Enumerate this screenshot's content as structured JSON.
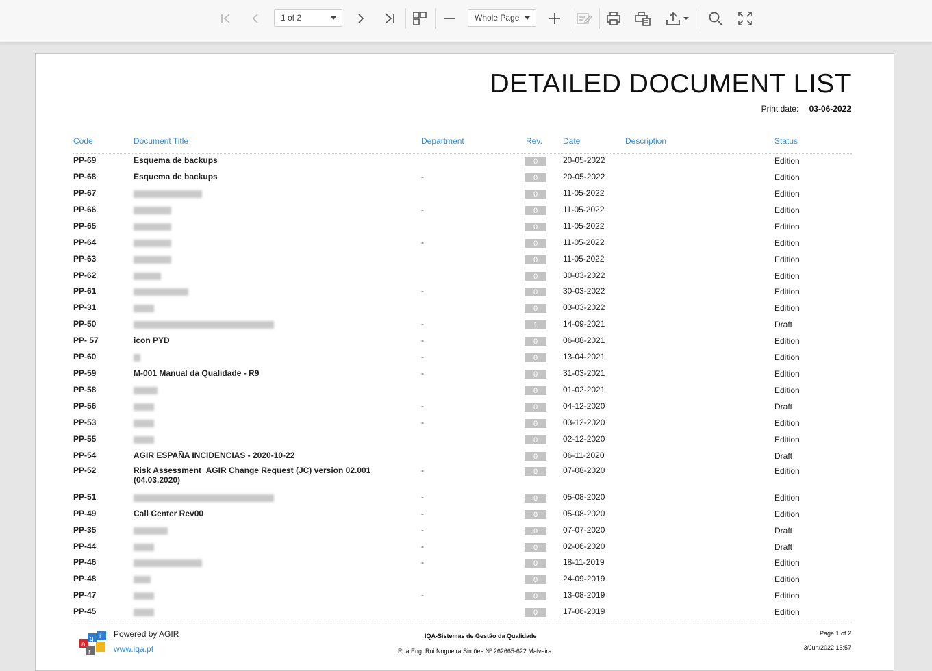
{
  "toolbar": {
    "page_select": "1 of 2",
    "zoom_select": "Whole Page"
  },
  "report": {
    "title": "DETAILED DOCUMENT LIST",
    "print_date_label": "Print date:",
    "print_date": "03-06-2022",
    "columns": {
      "code": "Code",
      "title": "Document Title",
      "department": "Department",
      "rev": "Rev.",
      "date": "Date",
      "description": "Description",
      "status": "Status"
    },
    "rows": [
      {
        "code": "PP-69",
        "title": "Esquema de backups",
        "dept": "",
        "rev": "0",
        "date": "20-05-2022",
        "status": "Edition"
      },
      {
        "code": "PP-68",
        "title": "Esquema de backups",
        "dept": "-",
        "rev": "0",
        "date": "20-05-2022",
        "status": "Edition"
      },
      {
        "code": "PP-67",
        "title": "",
        "dept": "",
        "rev": "0",
        "date": "11-05-2022",
        "status": "Edition"
      },
      {
        "code": "PP-66",
        "title": "",
        "dept": "-",
        "rev": "0",
        "date": "11-05-2022",
        "status": "Edition"
      },
      {
        "code": "PP-65",
        "title": "",
        "dept": "",
        "rev": "0",
        "date": "11-05-2022",
        "status": "Edition"
      },
      {
        "code": "PP-64",
        "title": "",
        "dept": "-",
        "rev": "0",
        "date": "11-05-2022",
        "status": "Edition"
      },
      {
        "code": "PP-63",
        "title": "",
        "dept": "",
        "rev": "0",
        "date": "11-05-2022",
        "status": "Edition"
      },
      {
        "code": "PP-62",
        "title": "",
        "dept": "",
        "rev": "0",
        "date": "30-03-2022",
        "status": "Edition"
      },
      {
        "code": "PP-61",
        "title": "",
        "dept": "-",
        "rev": "0",
        "date": "30-03-2022",
        "status": "Edition"
      },
      {
        "code": "PP-31",
        "title": "",
        "dept": "",
        "rev": "0",
        "date": "03-03-2022",
        "status": "Edition"
      },
      {
        "code": "PP-50",
        "title": "",
        "dept": "-",
        "rev": "1",
        "date": "14-09-2021",
        "status": "Draft"
      },
      {
        "code": "PP- 57",
        "title": "icon PYD",
        "dept": "-",
        "rev": "0",
        "date": "06-08-2021",
        "status": "Edition"
      },
      {
        "code": "PP-60",
        "title": "",
        "dept": "-",
        "rev": "0",
        "date": "13-04-2021",
        "status": "Edition"
      },
      {
        "code": "PP-59",
        "title": "M-001 Manual da Qualidade - R9",
        "dept": "-",
        "rev": "0",
        "date": "31-03-2021",
        "status": "Edition"
      },
      {
        "code": "PP-58",
        "title": "",
        "dept": "",
        "rev": "0",
        "date": "01-02-2021",
        "status": "Edition"
      },
      {
        "code": "PP-56",
        "title": "",
        "dept": "-",
        "rev": "0",
        "date": "04-12-2020",
        "status": "Draft"
      },
      {
        "code": "PP-53",
        "title": "",
        "dept": "-",
        "rev": "0",
        "date": "03-12-2020",
        "status": "Edition"
      },
      {
        "code": "PP-55",
        "title": "",
        "dept": "",
        "rev": "0",
        "date": "02-12-2020",
        "status": "Edition"
      },
      {
        "code": "PP-54",
        "title": "AGIR ESPAÑA INCIDENCIAS - 2020-10-22",
        "dept": "",
        "rev": "0",
        "date": "06-11-2020",
        "status": "Draft"
      },
      {
        "code": "PP-52",
        "title": "Risk Assessment_AGIR Change Request (JC) version 02.001 (04.03.2020)",
        "dept": "-",
        "rev": "0",
        "date": "07-08-2020",
        "status": "Edition"
      },
      {
        "code": "PP-51",
        "title": "",
        "dept": "-",
        "rev": "0",
        "date": "05-08-2020",
        "status": "Edition"
      },
      {
        "code": "PP-49",
        "title": "Call Center Rev00",
        "dept": "-",
        "rev": "0",
        "date": "05-08-2020",
        "status": "Edition"
      },
      {
        "code": "PP-35",
        "title": "",
        "dept": "-",
        "rev": "0",
        "date": "07-07-2020",
        "status": "Draft"
      },
      {
        "code": "PP-44",
        "title": "",
        "dept": "-",
        "rev": "0",
        "date": "02-06-2020",
        "status": "Draft"
      },
      {
        "code": "PP-46",
        "title": "",
        "dept": "-",
        "rev": "0",
        "date": "18-11-2019",
        "status": "Edition"
      },
      {
        "code": "PP-48",
        "title": "",
        "dept": "",
        "rev": "0",
        "date": "24-09-2019",
        "status": "Edition"
      },
      {
        "code": "PP-47",
        "title": "",
        "dept": "-",
        "rev": "0",
        "date": "13-08-2019",
        "status": "Edition"
      },
      {
        "code": "PP-45",
        "title": "",
        "dept": "",
        "rev": "0",
        "date": "17-06-2019",
        "status": "Edition"
      }
    ],
    "footer": {
      "powered": "Powered by AGIR",
      "site": "www.iqa.pt",
      "company": "IQA-Sistemas de Gestão da Qualidade",
      "address": "Rua Eng. Rui Nogueira Simões Nº 262665-622 Malveira",
      "page": "Page 1 of 2",
      "timestamp": "3/Jun/2022 15:57",
      "logo_letters": [
        "a",
        "g",
        "i",
        "r"
      ]
    }
  }
}
